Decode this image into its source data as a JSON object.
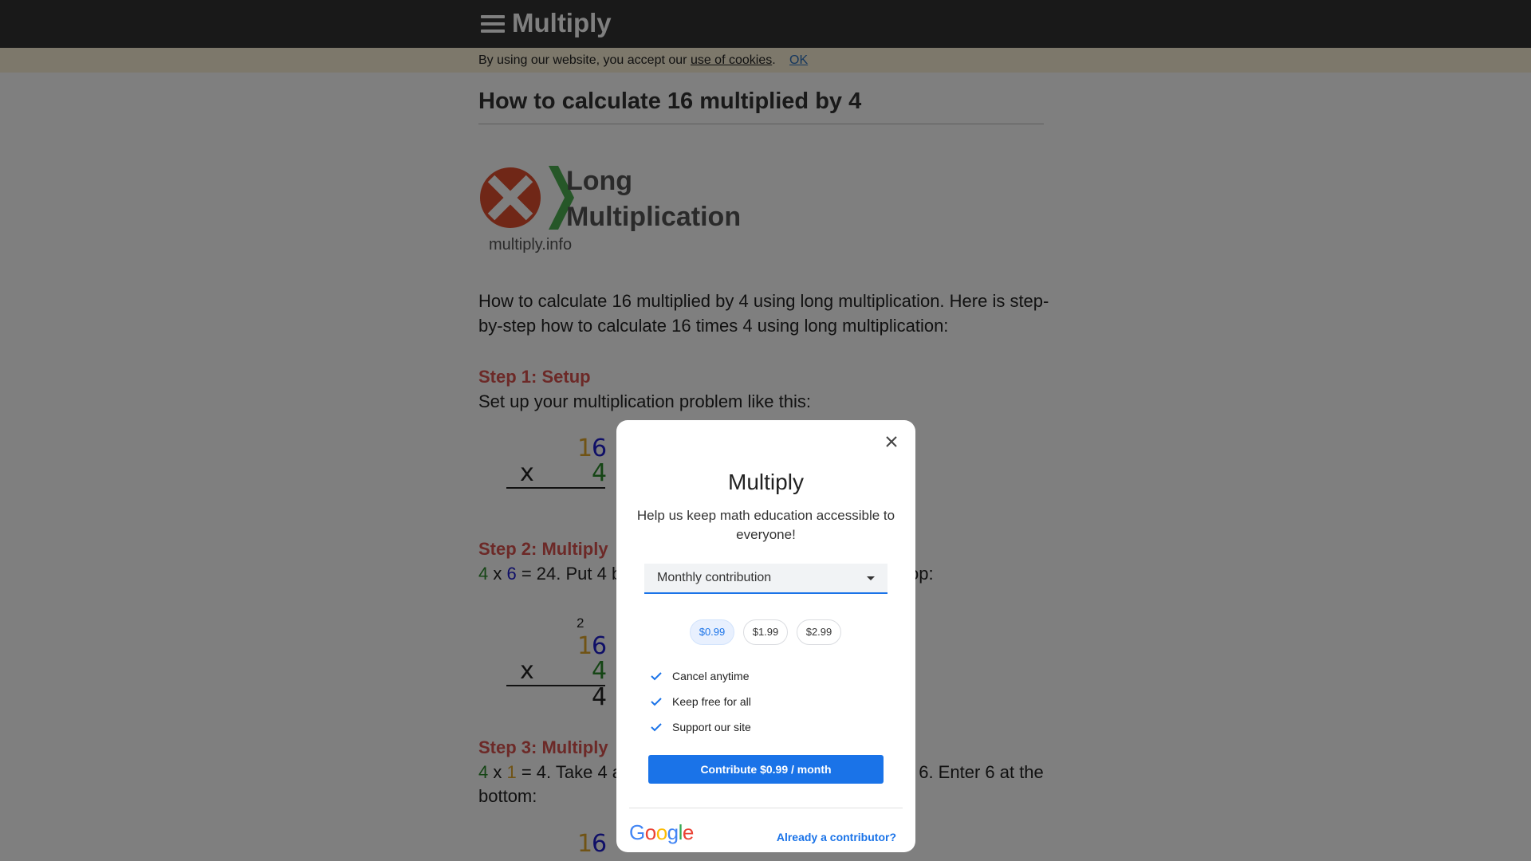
{
  "header": {
    "title": "Multiply"
  },
  "cookie": {
    "text": "By using our website, you accept our",
    "link": "use of cookies",
    "period": ".",
    "ok": "OK"
  },
  "page": {
    "title": "How to calculate 16 multiplied by 4",
    "logo": {
      "line1": "Long",
      "line2": "Multiplication",
      "url": "multiply.info"
    },
    "intro": "How to calculate 16 multiplied by 4 using long multiplication. Here is step-by-step how to calculate 16 times 4 using long multiplication:",
    "step1": {
      "heading": "Step 1: Setup",
      "text": "Set up your multiplication problem like this:"
    },
    "step2": {
      "heading": "Step 2: Multiply",
      "text_a": "4",
      "text_x": " x ",
      "text_b": "6",
      "text_rest": " = 24. Put 4 b",
      "text_tail": "op:"
    },
    "step3": {
      "heading": "Step 3: Multiply",
      "text_a": "4",
      "text_x": " x ",
      "text_b": "1",
      "text_rest": " = 4. Take 4 a",
      "text_tail": "t 6. Enter 6 at the",
      "text_line2": "bottom:"
    },
    "calc": {
      "top_tens": "1",
      "top_ones": "6",
      "x": "x",
      "bottom": "4",
      "carry": "2",
      "result_ones": "4"
    }
  },
  "dialog": {
    "title": "Multiply",
    "subtitle": "Help us keep math education accessible to everyone!",
    "select": "Monthly contribution",
    "amounts": [
      "$0.99",
      "$1.99",
      "$2.99"
    ],
    "benefits": [
      "Cancel anytime",
      "Keep free for all",
      "Support our site"
    ],
    "cta": "Contribute $0.99 / month",
    "google": "Google",
    "already": "Already a contributor?"
  },
  "colors": {
    "accent": "#1a73e8",
    "heading_red": "#d9534f",
    "topbar": "#333333"
  }
}
